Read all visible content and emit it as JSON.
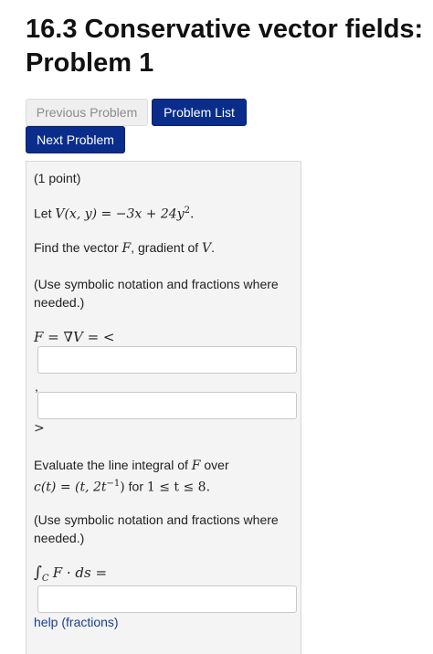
{
  "header": {
    "title_line1": "16.3 Conservative vector fields:",
    "title_line2": "Problem 1"
  },
  "nav": {
    "previous": "Previous Problem",
    "list": "Problem List",
    "next": "Next Problem"
  },
  "problem": {
    "points": "(1 point)",
    "let_text": "Let",
    "v_def": "V(x, y) = −3x + 24y",
    "v_exp": "2",
    "v_end": ".",
    "find_text": "Find the vector",
    "F": "F",
    "gradient_text": ", gradient of",
    "V": "V",
    "period": ".",
    "note1_line1": "(Use symbolic notation and fractions where",
    "note1_line2": "needed.)",
    "grad_lhs": "F = ∇V = <",
    "comma": ",",
    "close_angle": ">",
    "eval_text": "Evaluate the line integral of",
    "over_text": "over",
    "curve_lhs": "c(t) = (t, 2t",
    "curve_exp": "−1",
    "curve_rhs": ")",
    "for_text": "for",
    "range": "1 ≤ t ≤ 8.",
    "note2_line1": "(Use symbolic notation and fractions where",
    "note2_line2": "needed.)",
    "integral": "∫",
    "integral_sub": "C",
    "integral_expr": "F · ds =",
    "help": "help (fractions)"
  }
}
